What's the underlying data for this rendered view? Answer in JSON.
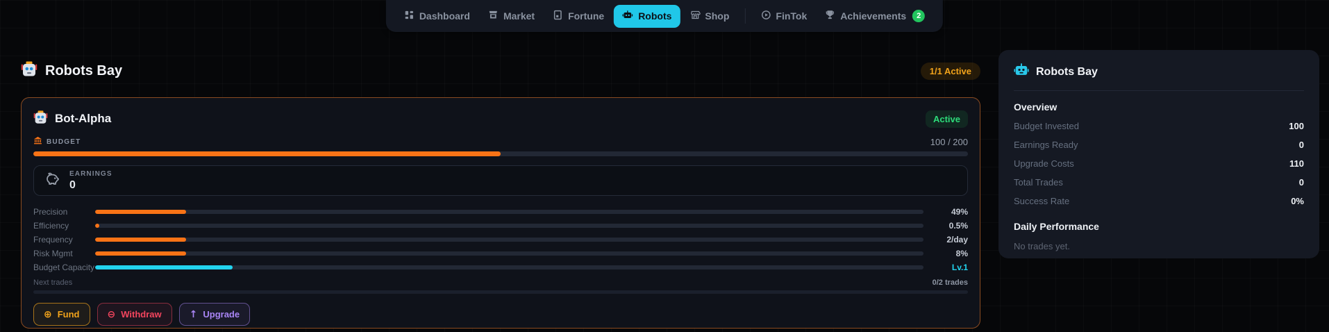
{
  "nav": {
    "items": [
      {
        "label": "Dashboard",
        "icon": "dashboard-icon",
        "active": false
      },
      {
        "label": "Market",
        "icon": "market-icon",
        "active": false
      },
      {
        "label": "Fortune",
        "icon": "fortune-icon",
        "active": false
      },
      {
        "label": "Robots",
        "icon": "robot-icon",
        "active": true
      },
      {
        "label": "Shop",
        "icon": "shop-icon",
        "active": false
      },
      {
        "label": "FinTok",
        "icon": "play-circle-icon",
        "active": false
      },
      {
        "label": "Achievements",
        "icon": "trophy-icon",
        "active": false,
        "badge": "2"
      }
    ]
  },
  "page": {
    "title": "Robots Bay",
    "active_badge": "1/1 Active"
  },
  "bot_card": {
    "name": "Bot-Alpha",
    "status": "Active",
    "budget": {
      "label": "Budget",
      "value_text": "100 / 200",
      "fill_pct": 50
    },
    "earnings": {
      "label": "EARNINGS",
      "value": "0"
    },
    "stats": [
      {
        "label": "Precision",
        "value": "49%",
        "fill_pct": 11,
        "color": "#f97316"
      },
      {
        "label": "Efficiency",
        "value": "0.5%",
        "fill_pct": 0.5,
        "color": "#f97316"
      },
      {
        "label": "Frequency",
        "value": "2/day",
        "fill_pct": 11,
        "color": "#f97316"
      },
      {
        "label": "Risk Mgmt",
        "value": "8%",
        "fill_pct": 11,
        "color": "#f97316"
      },
      {
        "label": "Budget Capacity",
        "value": "Lv.1",
        "fill_pct": 16.6,
        "color": "#22d3ee",
        "value_color": "#22d3ee"
      }
    ],
    "next_trades": {
      "label": "Next trades",
      "value": "0/2 trades",
      "fill_pct": 0
    },
    "buttons": [
      {
        "label": "Fund",
        "icon": "plus-circle-icon",
        "icon_glyph": "⊕",
        "color": "#f2a31b"
      },
      {
        "label": "Withdraw",
        "icon": "minus-circle-icon",
        "icon_glyph": "⊖",
        "color": "#f4455e"
      },
      {
        "label": "Upgrade",
        "icon": "arrow-up-icon",
        "icon_glyph": "↑",
        "color": "#a985f5"
      }
    ]
  },
  "sidebar": {
    "title": "Robots Bay",
    "overview": {
      "heading": "Overview",
      "rows": [
        {
          "label": "Budget Invested",
          "value": "100"
        },
        {
          "label": "Earnings Ready",
          "value": "0"
        },
        {
          "label": "Upgrade Costs",
          "value": "110"
        },
        {
          "label": "Total Trades",
          "value": "0"
        },
        {
          "label": "Success Rate",
          "value": "0%"
        }
      ]
    },
    "daily": {
      "heading": "Daily Performance",
      "empty_text": "No trades yet."
    }
  },
  "colors": {
    "orange": "#f97316",
    "cyan": "#22d3ee",
    "green": "#22c55e",
    "amber": "#f2a31b",
    "red": "#f4455e",
    "purple": "#a985f5",
    "nav_active": "#20c7e8"
  }
}
